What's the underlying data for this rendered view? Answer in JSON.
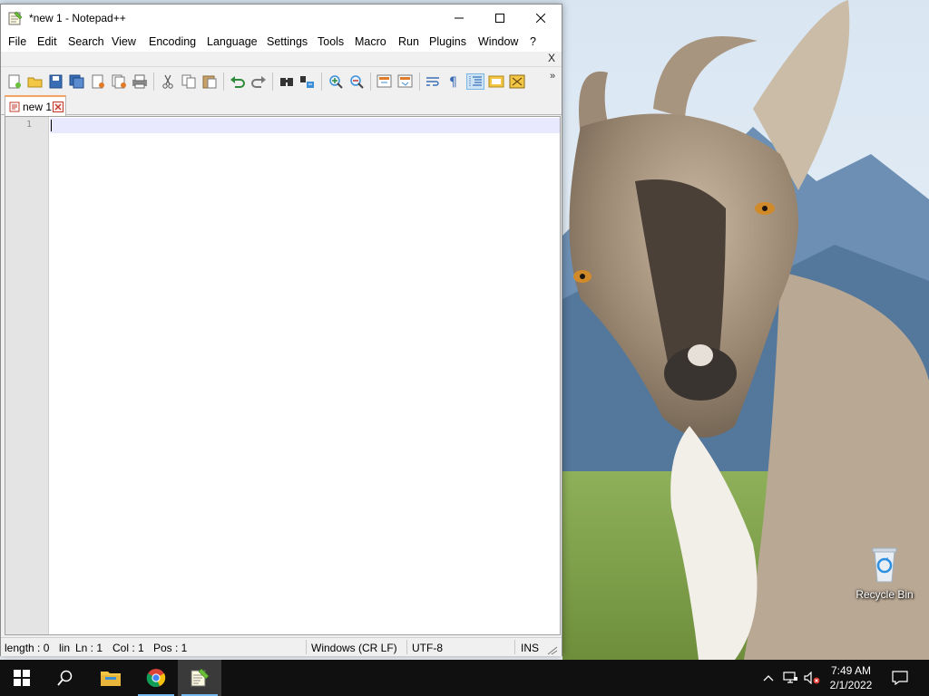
{
  "window": {
    "title": "*new 1 - Notepad++",
    "controls": {
      "minimize": "minimize",
      "maximize": "maximize",
      "close": "close"
    }
  },
  "menu": {
    "items": [
      "File",
      "Edit",
      "Search",
      "View",
      "Encoding",
      "Language",
      "Settings",
      "Tools",
      "Macro",
      "Run",
      "Plugins",
      "Window",
      "?"
    ],
    "close_doc": "X"
  },
  "toolbar": {
    "buttons": [
      "new-file",
      "open-file",
      "save",
      "save-all",
      "close",
      "close-all",
      "print",
      "cut",
      "copy",
      "paste",
      "undo",
      "redo",
      "find",
      "replace",
      "zoom-in",
      "zoom-out",
      "sync-vertical",
      "sync-horizontal",
      "word-wrap",
      "show-all-chars",
      "indent-guide",
      "function-list",
      "doc-map"
    ],
    "more": "»"
  },
  "tabs": [
    {
      "label": "new 1",
      "modified": true
    }
  ],
  "editor": {
    "line_numbers": [
      "1"
    ],
    "content": ""
  },
  "status": {
    "length": "length : 0",
    "lines": "lin",
    "ln": "Ln : 1",
    "col": "Col : 1",
    "pos": "Pos : 1",
    "eol": "Windows (CR LF)",
    "encoding": "UTF-8",
    "mode": "INS"
  },
  "desktop": {
    "icons": [
      {
        "label": "Recycle Bin",
        "icon": "recycle-bin-icon"
      }
    ]
  },
  "taskbar": {
    "apps": [
      "start-icon",
      "search-icon",
      "file-explorer-icon",
      "chrome-icon",
      "notepadpp-icon"
    ],
    "tray": [
      "chevron-up-icon",
      "network-icon",
      "volume-muted-icon"
    ],
    "time": "7:49 AM",
    "date": "2/1/2022",
    "notifications": "notification-icon"
  },
  "colors": {
    "taskbar": "#101010",
    "current_line": "#e8e8ff",
    "tab_accent": "#f4a460",
    "gutter": "#e4e4e4"
  }
}
